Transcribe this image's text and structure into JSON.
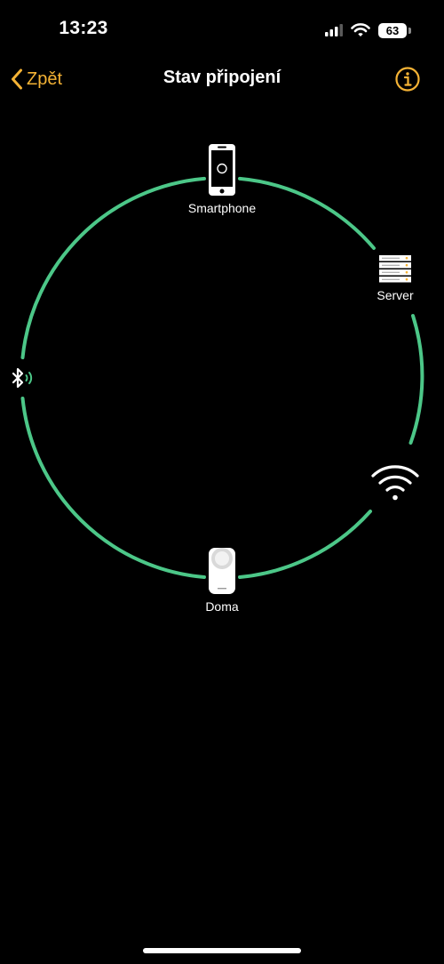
{
  "status_bar": {
    "time": "13:23",
    "battery": "63",
    "icons": [
      "cellular-signal-icon",
      "wifi-icon",
      "battery-icon"
    ]
  },
  "nav": {
    "back_label": "Zpět",
    "title": "Stav připojení",
    "icons": [
      "chevron-left-icon",
      "info-icon"
    ]
  },
  "diagram": {
    "ring_color": "#4cc788",
    "accent_color": "#f5b335",
    "nodes": {
      "smartphone": {
        "label": "Smartphone",
        "icon": "smartphone-icon"
      },
      "server": {
        "label": "Server",
        "icon": "server-icon"
      },
      "wifi": {
        "label": "",
        "icon": "wifi-icon"
      },
      "lock": {
        "label": "Doma",
        "icon": "smart-lock-icon"
      },
      "bluetooth": {
        "label": "",
        "icon": "bluetooth-icon"
      }
    }
  }
}
